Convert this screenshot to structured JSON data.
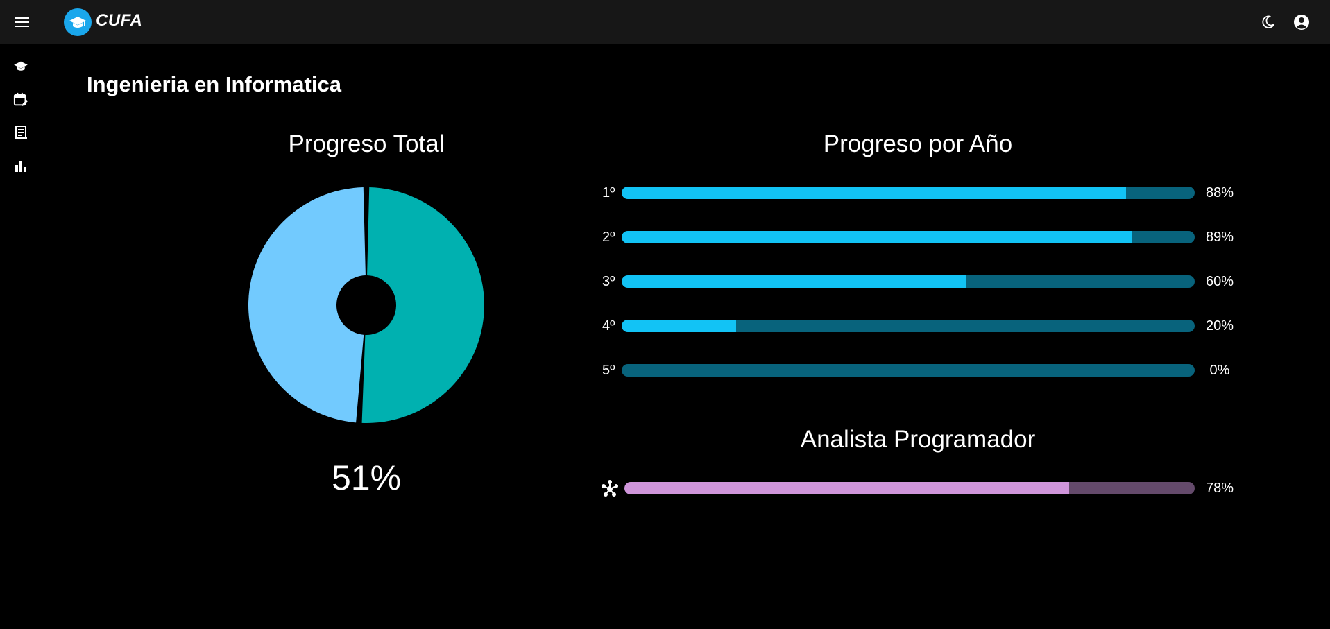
{
  "app": {
    "brand": "CUFA",
    "icons": {
      "menu": "menu-icon",
      "logo": "graduation-cap-icon",
      "theme": "moon-icon",
      "account": "account-circle-icon"
    }
  },
  "sidebar": {
    "items": [
      {
        "icon": "school-icon"
      },
      {
        "icon": "calendar-edit-icon"
      },
      {
        "icon": "receipt-icon"
      },
      {
        "icon": "bar-chart-icon"
      }
    ]
  },
  "page": {
    "title": "Ingenieria en Informatica"
  },
  "total": {
    "title": "Progreso Total",
    "percent_label": "51%",
    "percent": 51,
    "colors": {
      "done": "#00b1b0",
      "remaining": "#72cafe"
    }
  },
  "by_year": {
    "title": "Progreso por Año",
    "rows": [
      {
        "label": "1º",
        "pct_label": "88%",
        "value": 88
      },
      {
        "label": "2º",
        "pct_label": "89%",
        "value": 89
      },
      {
        "label": "3º",
        "pct_label": "60%",
        "value": 60
      },
      {
        "label": "4º",
        "pct_label": "20%",
        "value": 20
      },
      {
        "label": "5º",
        "pct_label": "0%",
        "value": 0
      }
    ],
    "colors": {
      "fill": "#12c3f5",
      "track": "#08637c"
    }
  },
  "analista": {
    "title": "Analista Programador",
    "icon": "hub-icon",
    "pct_label": "78%",
    "value": 78,
    "colors": {
      "fill": "#cf95da",
      "track": "#644a6b"
    }
  }
}
